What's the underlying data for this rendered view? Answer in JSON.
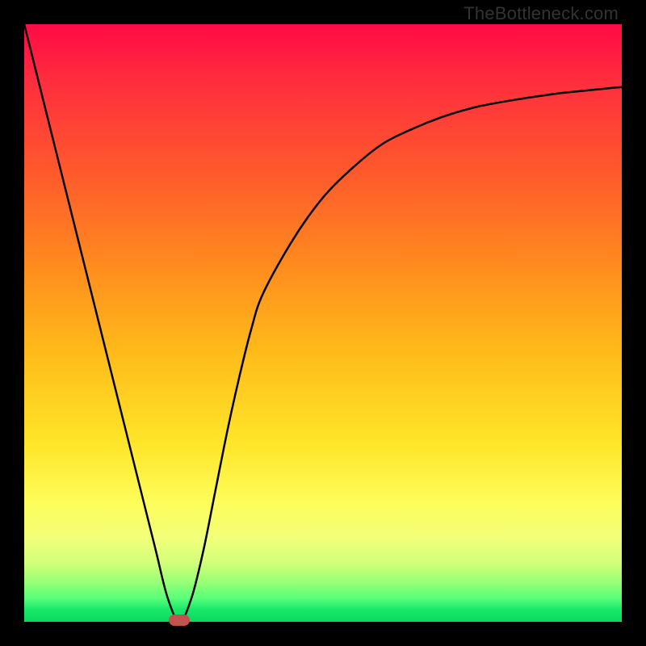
{
  "watermark": "TheBottleneck.com",
  "chart_data": {
    "type": "line",
    "title": "",
    "xlabel": "",
    "ylabel": "",
    "xlim": [
      0,
      100
    ],
    "ylim": [
      0,
      100
    ],
    "x": [
      0,
      5,
      10,
      15,
      20,
      22,
      24,
      26,
      28,
      30,
      32,
      34,
      36,
      38,
      40,
      45,
      50,
      55,
      60,
      65,
      70,
      75,
      80,
      85,
      90,
      95,
      100
    ],
    "values": [
      100,
      80,
      60,
      40,
      20,
      12,
      4,
      0,
      4,
      12,
      22,
      32,
      41,
      49,
      55,
      64,
      71,
      76,
      80,
      82.5,
      84.5,
      86,
      87,
      87.8,
      88.5,
      89,
      89.5
    ],
    "min_x": 26,
    "min_y": 0,
    "legend": false,
    "grid": false
  },
  "colors": {
    "curve": "#000000",
    "marker": "#c1534f"
  }
}
